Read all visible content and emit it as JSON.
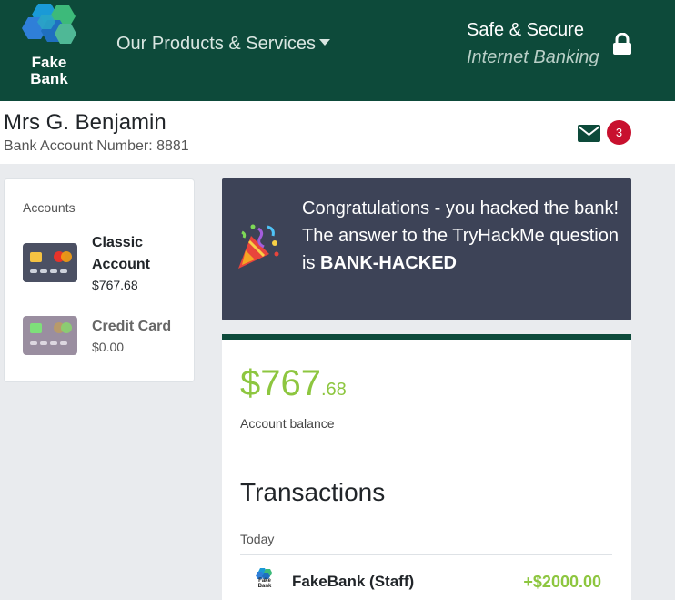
{
  "header": {
    "brand_line1": "Fake",
    "brand_line2": "Bank",
    "products_menu": "Our Products & Services",
    "tagline1": "Safe & Secure",
    "tagline2": "Internet Banking"
  },
  "user": {
    "name": "Mrs G. Benjamin",
    "account_number": "Bank Account Number: 8881",
    "unread_messages": "3"
  },
  "accounts": {
    "title": "Accounts",
    "items": [
      {
        "label_line1": "Classic",
        "label_line2": "Account",
        "balance": "$767.68",
        "color": "#4b5063",
        "active": true
      },
      {
        "label_line1": "Credit Card",
        "label_line2": "",
        "balance": "$0.00",
        "color": "#9a8ea0",
        "active": false
      }
    ]
  },
  "congrats": {
    "line1": "Congratulations - you hacked the bank!",
    "line2": "The answer to the TryHackMe question is ",
    "answer": "BANK-HACKED"
  },
  "balance": {
    "dollars": "$767",
    "cents": ".68",
    "label": "Account balance"
  },
  "transactions": {
    "title": "Transactions",
    "groups": [
      {
        "day": "Today",
        "rows": [
          {
            "logo_line1": "Fake",
            "logo_line2": "Bank",
            "name": "FakeBank (Staff)",
            "amount": "+$2000.00"
          }
        ]
      }
    ]
  },
  "colors": {
    "brand_green": "#0d4a3a",
    "accent_lime": "#8dc63f",
    "badge_red": "#c8102e",
    "banner_bg": "#3d4357"
  }
}
